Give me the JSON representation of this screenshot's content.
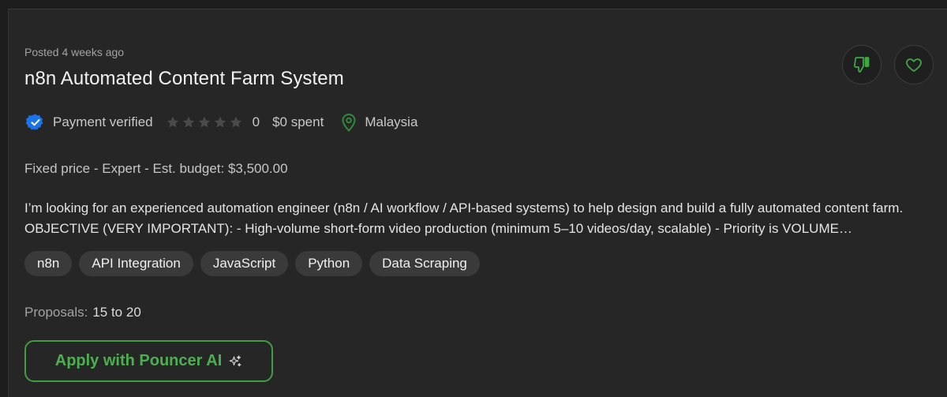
{
  "job": {
    "posted": "Posted 4 weeks ago",
    "title": "n8n Automated Content Farm System",
    "payment_status": "Payment verified",
    "rating": 0,
    "rating_max": 5,
    "rating_count": "0",
    "spent": "$0 spent",
    "location": "Malaysia",
    "budget_line": "Fixed price - Expert - Est. budget: $3,500.00",
    "description": "I’m looking for an experienced automation engineer (n8n / AI workflow / API-based systems) to help design and build a fully automated content farm. OBJECTIVE (VERY IMPORTANT): - High-volume short-form video production (minimum 5–10 videos/day, scalable) - Priority is VOLUME…",
    "tags": [
      "n8n",
      "API Integration",
      "JavaScript",
      "Python",
      "Data Scraping"
    ],
    "proposals_label": "Proposals:",
    "proposals_value": "15 to 20",
    "apply_label": "Apply with Pouncer AI"
  },
  "icons": {
    "dislike": "thumbs-down-icon",
    "save": "heart-icon",
    "verified": "verified-badge-icon",
    "location": "map-pin-icon",
    "sparkle": "sparkle-icon"
  },
  "colors": {
    "accent_green": "#4caf50",
    "verified_blue": "#1a73e8",
    "background": "#262626"
  }
}
